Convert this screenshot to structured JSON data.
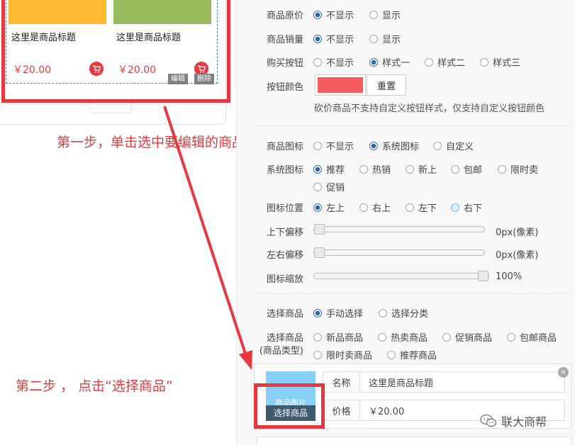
{
  "preview": {
    "products": [
      {
        "title": "这里是商品标题",
        "price": "￥20.00",
        "image_color": "#ffb830"
      },
      {
        "title": "这里是商品标题",
        "price": "￥20.00",
        "image_color": "#97bb5c"
      }
    ],
    "edit_label": "编辑",
    "delete_label": "删除"
  },
  "annotations": {
    "step1": "第一步，单击选中要编辑的商品组",
    "step2": "第二步 ， 点击“选择商品”",
    "color": "#e8383d"
  },
  "settings": {
    "original_price": {
      "label": "商品原价",
      "options": [
        "不显示",
        "显示"
      ],
      "selected": "不显示"
    },
    "sales": {
      "label": "商品销量",
      "options": [
        "不显示",
        "显示"
      ],
      "selected": "不显示"
    },
    "buy_button": {
      "label": "购买按钮",
      "options": [
        "不显示",
        "样式一",
        "样式二",
        "样式三"
      ],
      "selected": "样式一"
    },
    "button_color": {
      "label": "按钮颜色",
      "color": "#f55a5f",
      "reset_label": "重置"
    },
    "bargain_hint": "砍价商品不支持自定义按钮样式，仅支持自定义按钮颜色",
    "product_icon": {
      "label": "商品图标",
      "options": [
        "不显示",
        "系统图标",
        "自定义"
      ],
      "selected": "系统图标"
    },
    "system_icon": {
      "label": "系统图标",
      "options": [
        "推荐",
        "热销",
        "新上",
        "包邮",
        "限时卖",
        "促销"
      ],
      "selected": "推荐"
    },
    "icon_position": {
      "label": "图标位置",
      "options": [
        "左上",
        "右上",
        "左下",
        "右下"
      ],
      "selected": "左上"
    },
    "v_offset": {
      "label": "上下偏移",
      "value": "0px(像素)",
      "level": 0
    },
    "h_offset": {
      "label": "左右偏移",
      "value": "0px(像素)",
      "level": 0
    },
    "icon_scale": {
      "label": "图标缩放",
      "value": "100%",
      "level": 1
    },
    "select_product": {
      "label": "选择商品",
      "options": [
        "手动选择",
        "选择分类"
      ],
      "selected": "手动选择"
    },
    "product_type": {
      "label": "选择商品",
      "label_sub": "(商品类型)",
      "options": [
        "新品商品",
        "热卖商品",
        "促销商品",
        "包邮商品",
        "限时卖商品",
        "推荐商品"
      ]
    }
  },
  "product_card": {
    "image_placeholder": "商品图片",
    "pick_button": "选择商品",
    "name_key": "名称",
    "name_value": "这里是商品标题",
    "price_key": "价格",
    "price_value": "￥20.00",
    "close_symbol": "×"
  },
  "watermark": "联大商帮"
}
